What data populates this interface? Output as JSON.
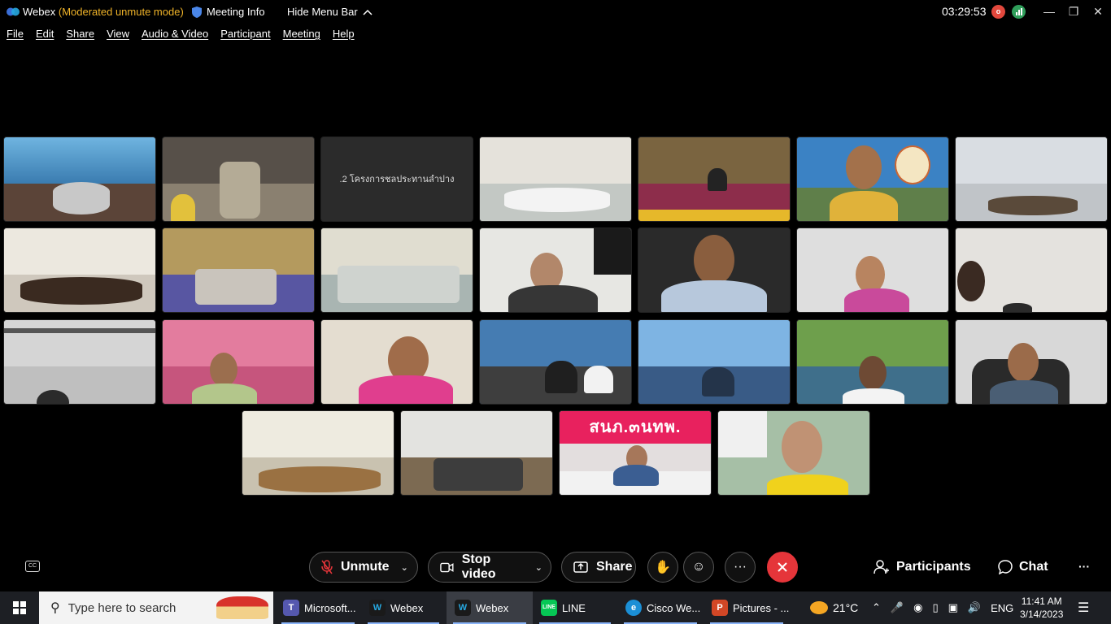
{
  "titlebar": {
    "app_name": "Webex",
    "mode": "(Moderated unmute mode)",
    "meeting_info": "Meeting Info",
    "hide_menu": "Hide Menu Bar",
    "time": "03:29:53",
    "rec_badge": "o"
  },
  "menu": [
    "File",
    "Edit",
    "Share",
    "View",
    "Audio & Video",
    "Participant",
    "Meeting",
    "Help"
  ],
  "tiles": {
    "placeholder_name": ".2 โครงการชลประทานลำปาง",
    "banner_text": "สนภ.๓นทพ."
  },
  "controls": {
    "unmute": "Unmute",
    "stop_video": "Stop video",
    "share": "Share",
    "participants": "Participants",
    "chat": "Chat",
    "cc": "CC"
  },
  "taskbar": {
    "search_placeholder": "Type here to search",
    "apps": [
      "Microsoft...",
      "Webex",
      "Webex",
      "LINE",
      "Cisco We...",
      "Pictures - ..."
    ],
    "temperature": "21°C",
    "language": "ENG",
    "clock_time": "11:41 AM",
    "clock_date": "3/14/2023"
  },
  "colors": {
    "accent_mode": "#f0b429",
    "end_call": "#e5353a",
    "background": "#000000"
  }
}
